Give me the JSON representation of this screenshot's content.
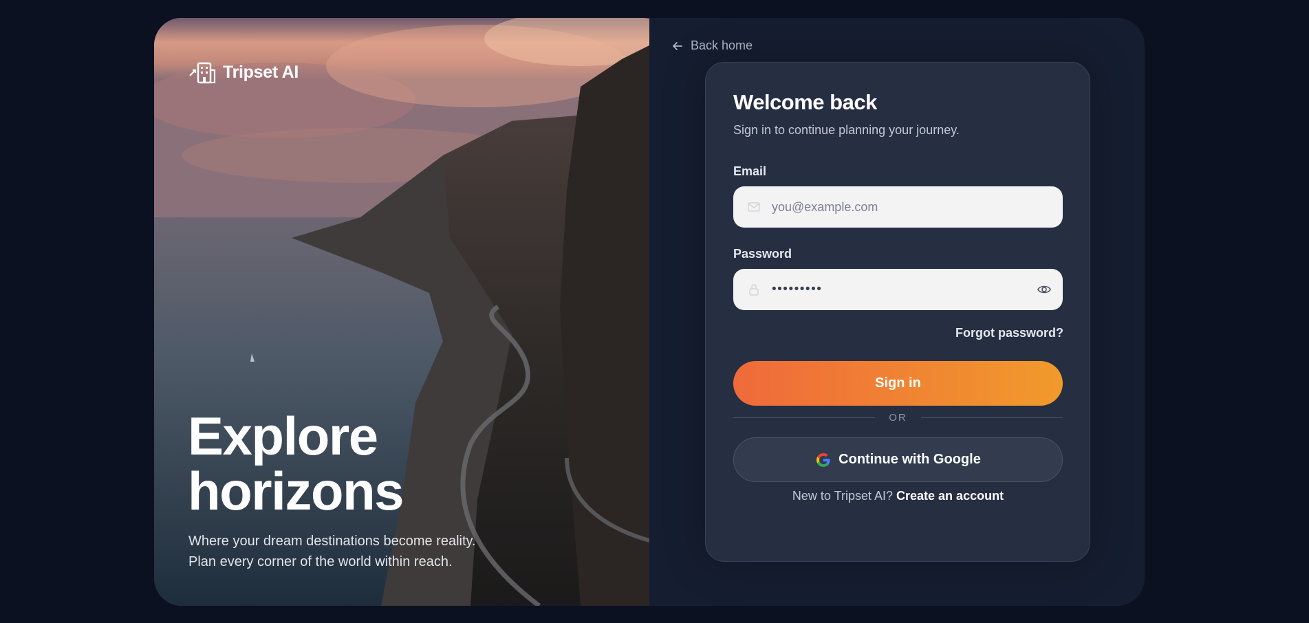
{
  "brand": {
    "name": "Tripset AI",
    "icon": "hotel-icon"
  },
  "hero": {
    "title_line1": "Explore",
    "title_line2": "horizons",
    "subtitle_line1": "Where your dream destinations become reality.",
    "subtitle_line2": "Plan every corner of the world within reach."
  },
  "nav": {
    "back_label": "Back home",
    "back_icon": "arrow-left-icon"
  },
  "form": {
    "title": "Welcome back",
    "subtitle": "Sign in to continue planning your journey.",
    "email_label": "Email",
    "email_placeholder": "you@example.com",
    "email_icon": "mail-icon",
    "password_label": "Password",
    "password_value": "•••••••••",
    "password_icon": "lock-icon",
    "show_password_icon": "eye-icon",
    "forgot_label": "Forgot password?",
    "signin_label": "Sign in",
    "divider_label": "OR",
    "google_label": "Continue with Google",
    "signup_prompt": "New to Tripset AI?",
    "signup_link": "Create an account"
  },
  "colors": {
    "background": "#0b1120",
    "card": "#262e42",
    "accent_start": "#ef6a3a",
    "accent_end": "#f19a2c"
  }
}
